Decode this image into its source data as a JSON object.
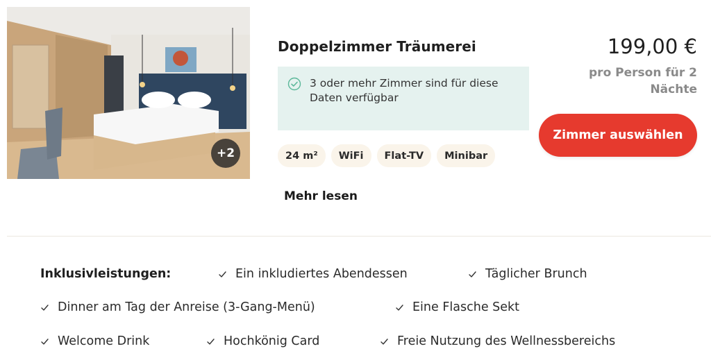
{
  "room": {
    "title": "Doppelzimmer Träumerei",
    "photo_count_label": "+2",
    "availability": "3 oder mehr Zimmer sind für diese Daten verfügbar",
    "features": [
      "24 m²",
      "WiFi",
      "Flat-TV",
      "Minibar"
    ],
    "read_more_label": "Mehr lesen"
  },
  "pricing": {
    "price": "199,00 €",
    "note": "pro Person für 2 Nächte",
    "select_label": "Zimmer auswählen"
  },
  "inclusions": {
    "heading": "Inklusivleistungen:",
    "items": [
      "Ein inkludiertes Abendessen",
      "Täglicher Brunch",
      "Dinner am Tag der Anreise (3-Gang-Menü)",
      "Eine Flasche Sekt",
      "Welcome Drink",
      "Hochkönig Card",
      "Freie Nutzung des Wellnessbereichs"
    ]
  },
  "icons": {
    "availability": "check-circle-icon",
    "inclusion": "check-icon"
  },
  "colors": {
    "accent": "#e63a2e",
    "availability_bg": "#e5f2ef",
    "tag_bg": "#faf4ea",
    "check_green": "#5bb89a"
  }
}
